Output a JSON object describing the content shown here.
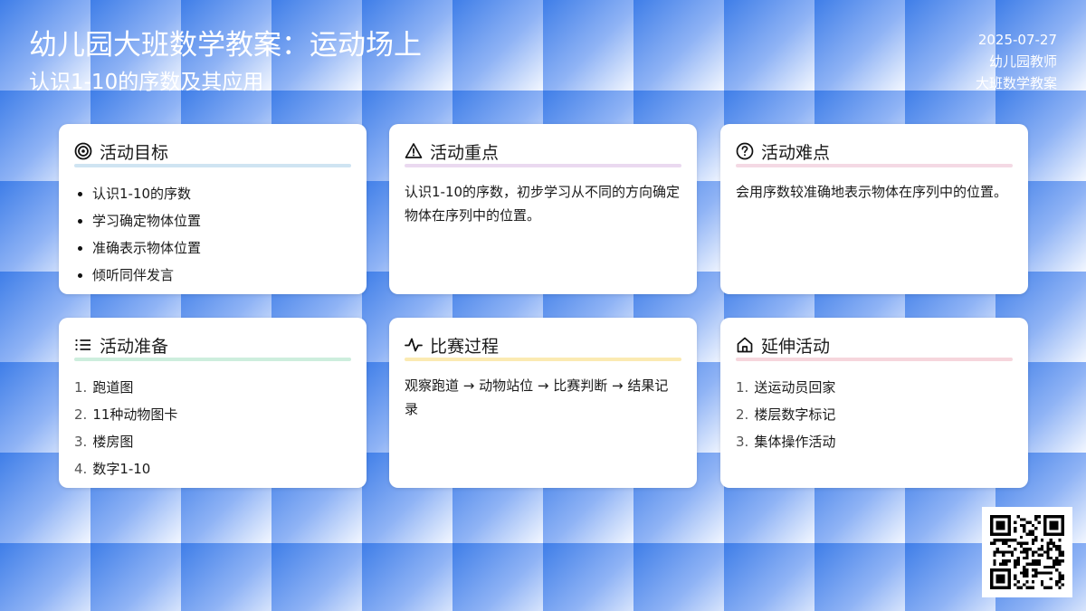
{
  "header": {
    "title": "幼儿园大班数学教案：运动场上",
    "subtitle": "认识1-10的序数及其应用",
    "date": "2025-07-27",
    "author": "幼儿园教师",
    "category": "大班数学教案"
  },
  "colors": {
    "underline_blue": "#cfe4f2",
    "underline_purple": "#ead9f0",
    "underline_pink": "#f4d9e4",
    "underline_green": "#cdeedd",
    "underline_yellow": "#fbeab2",
    "underline_rose": "#f6d6dc"
  },
  "cards": {
    "goals": {
      "icon": "target-icon",
      "title": "活动目标",
      "items": [
        "认识1-10的序数",
        "学习确定物体位置",
        "准确表示物体位置",
        "倾听同伴发言"
      ]
    },
    "focus": {
      "icon": "warning-triangle-icon",
      "title": "活动重点",
      "text": "认识1-10的序数，初步学习从不同的方向确定物体在序列中的位置。"
    },
    "difficulty": {
      "icon": "question-circle-icon",
      "title": "活动难点",
      "text": "会用序数较准确地表示物体在序列中的位置。"
    },
    "prep": {
      "icon": "list-icon",
      "title": "活动准备",
      "items": [
        {
          "num": "1.",
          "label": "跑道图"
        },
        {
          "num": "2.",
          "label": "11种动物图卡"
        },
        {
          "num": "3.",
          "label": "楼房图"
        },
        {
          "num": "4.",
          "label": "数字1-10"
        }
      ]
    },
    "process": {
      "icon": "activity-pulse-icon",
      "title": "比赛过程",
      "text": "观察跑道 → 动物站位 → 比赛判断 → 结果记录"
    },
    "extension": {
      "icon": "home-icon",
      "title": "延伸活动",
      "items": [
        {
          "num": "1.",
          "label": "送运动员回家"
        },
        {
          "num": "2.",
          "label": "楼层数字标记"
        },
        {
          "num": "3.",
          "label": "集体操作活动"
        }
      ]
    }
  },
  "qr": {
    "icon": "qr-code-icon"
  }
}
